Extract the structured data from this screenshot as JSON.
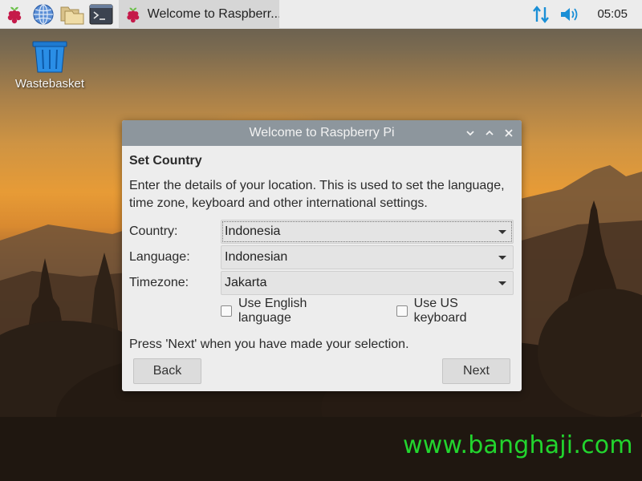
{
  "taskbar": {
    "launchers": [
      {
        "icon": "raspberry-menu-icon"
      },
      {
        "icon": "web-browser-icon"
      },
      {
        "icon": "file-manager-icon"
      },
      {
        "icon": "terminal-icon"
      }
    ],
    "task_label": "Welcome to Raspberr...",
    "task_icon": "raspberry-icon",
    "tray": {
      "network_icon": "network-arrows-icon",
      "volume_icon": "volume-icon",
      "clock": "05:05"
    }
  },
  "desktop": {
    "icons": [
      {
        "label": "Wastebasket",
        "icon": "wastebasket-icon"
      }
    ]
  },
  "dialog": {
    "title": "Welcome to Raspberry Pi",
    "heading": "Set Country",
    "description": "Enter the details of your location. This is used to set the language, time zone, keyboard and other international settings.",
    "fields": [
      {
        "label": "Country:",
        "value": "Indonesia"
      },
      {
        "label": "Language:",
        "value": "Indonesian"
      },
      {
        "label": "Timezone:",
        "value": "Jakarta"
      }
    ],
    "checkboxes": [
      {
        "label": "Use English language",
        "checked": false
      },
      {
        "label": "Use US keyboard",
        "checked": false
      }
    ],
    "hint": "Press 'Next' when you have made your selection.",
    "back_label": "Back",
    "next_label": "Next"
  },
  "watermark": "www.banghaji.com",
  "colors": {
    "titlebar": "#8d969d",
    "tray_accent": "#1a8fd6",
    "raspberry_red": "#c51a4a",
    "raspberry_leaf": "#6cc04a",
    "watermark": "#22d52e"
  }
}
